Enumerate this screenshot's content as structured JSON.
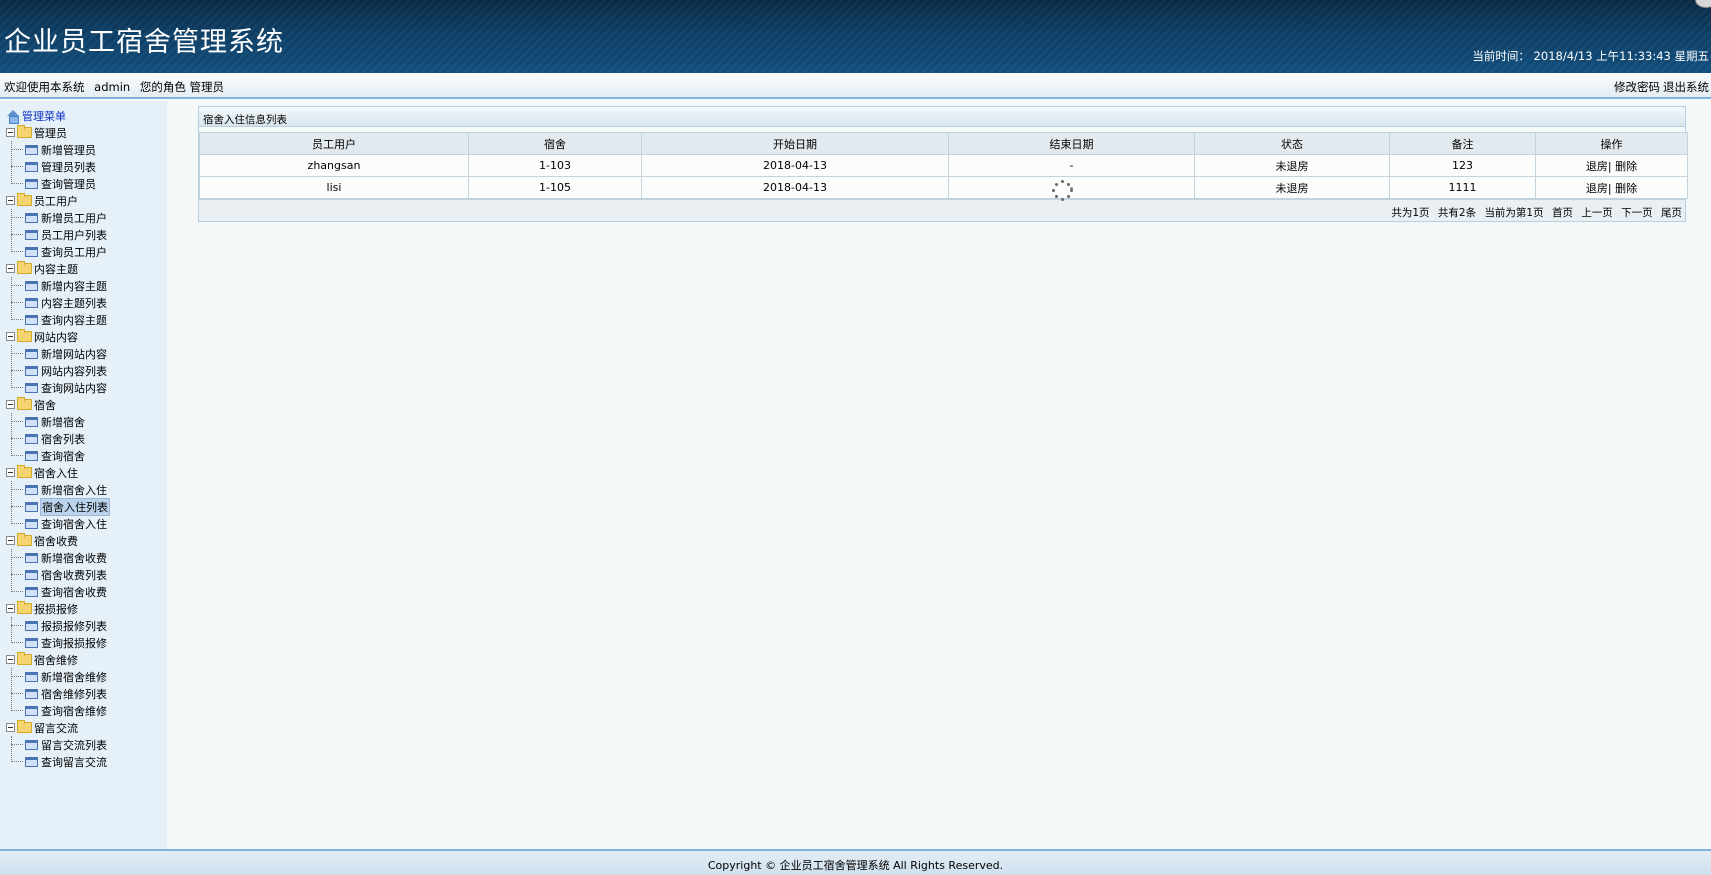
{
  "header": {
    "title": "企业员工宿舍管理系统",
    "clock": "当前时间： 2018/4/13 上午11:33:43 星期五"
  },
  "welcome": {
    "greeting": "欢迎使用本系统",
    "user": "admin",
    "role": "您的角色 管理员",
    "change_password": "修改密码",
    "logout": "退出系统"
  },
  "sidebar": {
    "root": "管理菜单",
    "groups": [
      {
        "label": "管理员",
        "items": [
          "新增管理员",
          "管理员列表",
          "查询管理员"
        ]
      },
      {
        "label": "员工用户",
        "items": [
          "新增员工用户",
          "员工用户列表",
          "查询员工用户"
        ]
      },
      {
        "label": "内容主题",
        "items": [
          "新增内容主题",
          "内容主题列表",
          "查询内容主题"
        ]
      },
      {
        "label": "网站内容",
        "items": [
          "新增网站内容",
          "网站内容列表",
          "查询网站内容"
        ]
      },
      {
        "label": "宿舍",
        "items": [
          "新增宿舍",
          "宿舍列表",
          "查询宿舍"
        ]
      },
      {
        "label": "宿舍入住",
        "items": [
          "新增宿舍入住",
          "宿舍入住列表",
          "查询宿舍入住"
        ]
      },
      {
        "label": "宿舍收费",
        "items": [
          "新增宿舍收费",
          "宿舍收费列表",
          "查询宿舍收费"
        ]
      },
      {
        "label": "报损报修",
        "items": [
          "报损报修列表",
          "查询报损报修"
        ]
      },
      {
        "label": "宿舍维修",
        "items": [
          "新增宿舍维修",
          "宿舍维修列表",
          "查询宿舍维修"
        ]
      },
      {
        "label": "留言交流",
        "items": [
          "留言交流列表",
          "查询留言交流"
        ]
      }
    ],
    "active_item": "宿舍入住列表"
  },
  "panel": {
    "title": "宿舍入住信息列表",
    "columns": [
      "员工用户",
      "宿舍",
      "开始日期",
      "结束日期",
      "状态",
      "备注",
      "操作"
    ],
    "rows": [
      {
        "user": "zhangsan",
        "dorm": "1-103",
        "start": "2018-04-13",
        "end": "-",
        "status": "未退房",
        "note": "123",
        "action_checkout": "退房",
        "action_delete": "删除"
      },
      {
        "user": "lisi",
        "dorm": "1-105",
        "start": "2018-04-13",
        "end": "-",
        "status": "未退房",
        "note": "1111",
        "action_checkout": "退房",
        "action_delete": "删除"
      }
    ],
    "pager": {
      "total_pages": "共为1页",
      "total_records": "共有2条",
      "current_page": "当前为第1页",
      "first": "首页",
      "prev": "上一页",
      "next": "下一页",
      "last": "尾页"
    }
  },
  "footer": {
    "copyright": "Copyright © 企业员工宿舍管理系统 All Rights Reserved."
  },
  "colors": {
    "header_bg": "#0d3f66",
    "accent_border": "#7fb3dc",
    "sidebar_bg": "#e6f0f8",
    "root_link": "#0b30c4"
  }
}
